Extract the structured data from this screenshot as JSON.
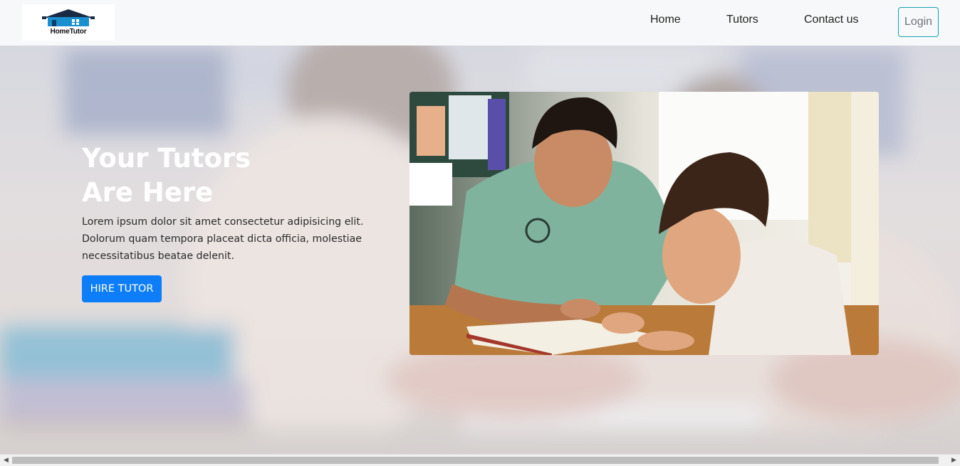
{
  "brand": {
    "logo_text": "HomeTutor",
    "logo_icon": "house-logo-icon"
  },
  "nav": {
    "items": [
      {
        "label": "Home"
      },
      {
        "label": "Tutors"
      },
      {
        "label": "Contact us"
      }
    ],
    "login_label": "Login"
  },
  "hero": {
    "title_line1": "Your Tutors",
    "title_line2": "Are Here",
    "description": "Lorem ipsum dolor sit amet consectetur adipisicing elit. Dolorum quam tempora placeat dicta officia, molestiae necessitatibus beatae delenit.",
    "cta_label": "HIRE TUTOR",
    "image": "tutor-and-student-reading-photo"
  },
  "colors": {
    "primary": "#0d7ef7",
    "login_border": "#17a2b8",
    "navbar_bg": "#f7f8f9",
    "hero_title": "#ffffff"
  },
  "scrollbar": {
    "left_arrow": "◀",
    "right_arrow": "▶"
  }
}
